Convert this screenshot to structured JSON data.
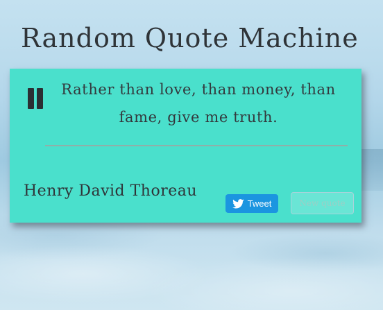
{
  "page": {
    "title": "Random Quote Machine"
  },
  "quote": {
    "text": "Rather than love, than money, than fame, give me truth.",
    "author": "Henry David Thoreau"
  },
  "actions": {
    "tweet_label": "Tweet",
    "new_quote_label": "New quote"
  },
  "icons": {
    "quote_mark": "quote-icon",
    "tweet": "twitter-bird-icon"
  },
  "colors": {
    "card_background": "#4ae0cc",
    "tweet_button": "#1b95e0",
    "text": "#2f3438"
  }
}
